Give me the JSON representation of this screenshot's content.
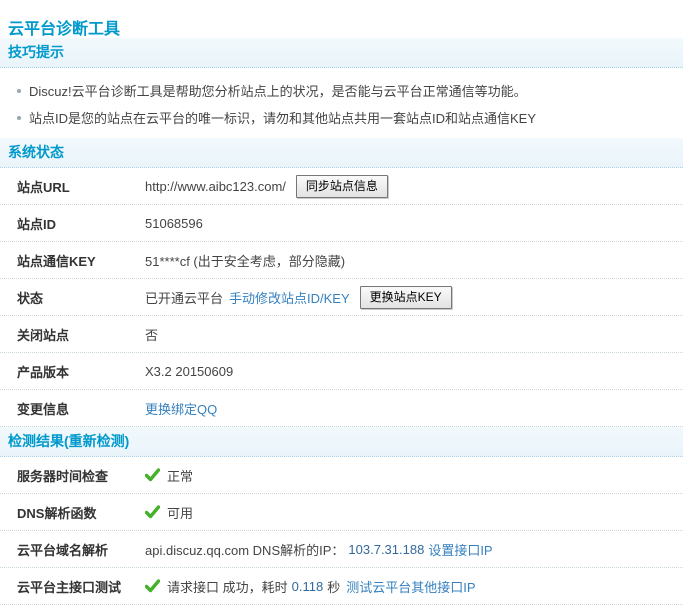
{
  "page": {
    "title": "云平台诊断工具"
  },
  "tips": {
    "header": "技巧提示",
    "items": [
      "Discuz!云平台诊断工具是帮助您分析站点上的状况，是否能与云平台正常通信等功能。",
      "站点ID是您的站点在云平台的唯一标识，请勿和其他站点共用一套站点ID和站点通信KEY"
    ]
  },
  "system_status": {
    "header": "系统状态",
    "site_url": {
      "label": "站点URL",
      "value": "http://www.aibc123.com/",
      "button": "同步站点信息"
    },
    "site_id": {
      "label": "站点ID",
      "value": "51068596"
    },
    "site_key": {
      "label": "站点通信KEY",
      "value": "51****cf (出于安全考虑，部分隐藏)"
    },
    "status": {
      "label": "状态",
      "value": "已开通云平台",
      "link": "手动修改站点ID/KEY",
      "button": "更换站点KEY"
    },
    "site_closed": {
      "label": "关闭站点",
      "value": "否"
    },
    "product_version": {
      "label": "产品版本",
      "value": "X3.2 20150609"
    },
    "change_info": {
      "label": "变更信息",
      "link": "更换绑定QQ"
    }
  },
  "detection": {
    "header": "检测结果",
    "recheck_link": "(重新检测)",
    "server_time": {
      "label": "服务器时间检查",
      "value": "正常",
      "status_icon": "success-check-icon"
    },
    "dns_function": {
      "label": "DNS解析函数",
      "value": "可用",
      "status_icon": "success-check-icon"
    },
    "domain_resolution": {
      "label": "云平台域名解析",
      "text": "api.discuz.qq.com DNS解析的IP：",
      "ip": "103.7.31.188",
      "link": "设置接口IP"
    },
    "main_api_test": {
      "label": "云平台主接口测试",
      "text": "请求接口 成功，耗时",
      "seconds": "0.118",
      "unit": "秒",
      "link": "测试云平台其他接口IP",
      "status_icon": "success-check-icon"
    }
  },
  "colors": {
    "accent_blue": "#0099CC",
    "link_blue": "#3580BF",
    "success_green": "#45B129",
    "section_bar_bg": "#EDF6FB"
  }
}
